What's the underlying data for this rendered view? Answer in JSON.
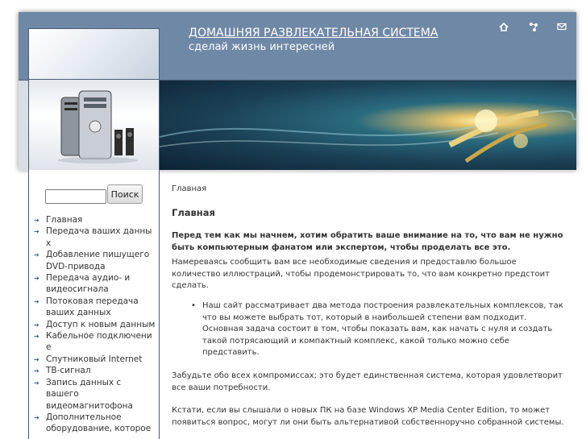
{
  "header": {
    "title": "ДОМАШНЯЯ РАЗВЛЕКАТЕЛЬНАЯ СИСТЕМА",
    "subtitle": "сделай жизнь интересней",
    "icons": [
      "home-icon",
      "sitemap-icon",
      "mail-icon"
    ]
  },
  "search": {
    "placeholder": "",
    "button_label": "Поиск"
  },
  "sidebar": {
    "items": [
      {
        "label": "Главная"
      },
      {
        "label": "Передача ваших данны х"
      },
      {
        "label": "Добавление пишущего DVD-привода"
      },
      {
        "label": "Передача аудио- и видеосигнала"
      },
      {
        "label": "Потоковая передача ваших данных"
      },
      {
        "label": "Доступ к новым данным"
      },
      {
        "label": "Кабельное подключени е"
      },
      {
        "label": "Спутниковый Internet"
      },
      {
        "label": "ТВ-сигнал"
      },
      {
        "label": "Запись данных с вашего видеомагнитофона"
      },
      {
        "label": "Дополнительное оборудование, которое"
      }
    ]
  },
  "content": {
    "breadcrumb": "Главная",
    "title": "Главная",
    "lead": "Перед тем как мы начнем, хотим  обратить ваше внимание на то, что вам не нужно быть компьютерным фанатом или экспертом, чтобы проделать все это.",
    "p1": "Намереваясь сообщить вам все необходимые сведения и предоставлю большое количество иллюстраций, чтобы продемонстрировать то, что вам конкретно предстоит сделать.",
    "bullet": "Наш сайт рассматривает два метода построения развлекательных комплексов, так что вы можете выбрать тот, который в наибольшей степени вам подходит. Основная задача состоит в том, чтобы показать вам, как начать с нуля и создать такой потрясающий и компактный комплекс, какой только можно себе представить.",
    "p2": "Забудьте обо всех компромиссах; это будет единственная система, которая удовлетворит все ваши потребности.",
    "p3": "Кстати, если вы слышали о новых ПК на базе Windows XP Media Center Edition, то может появиться вопрос, могут ли они быть альтернативой собственноручно собранной системы."
  },
  "colors": {
    "header_bg": "#6f88a6",
    "border": "#4b5d72",
    "menu_icon": "#3a5e8a"
  }
}
